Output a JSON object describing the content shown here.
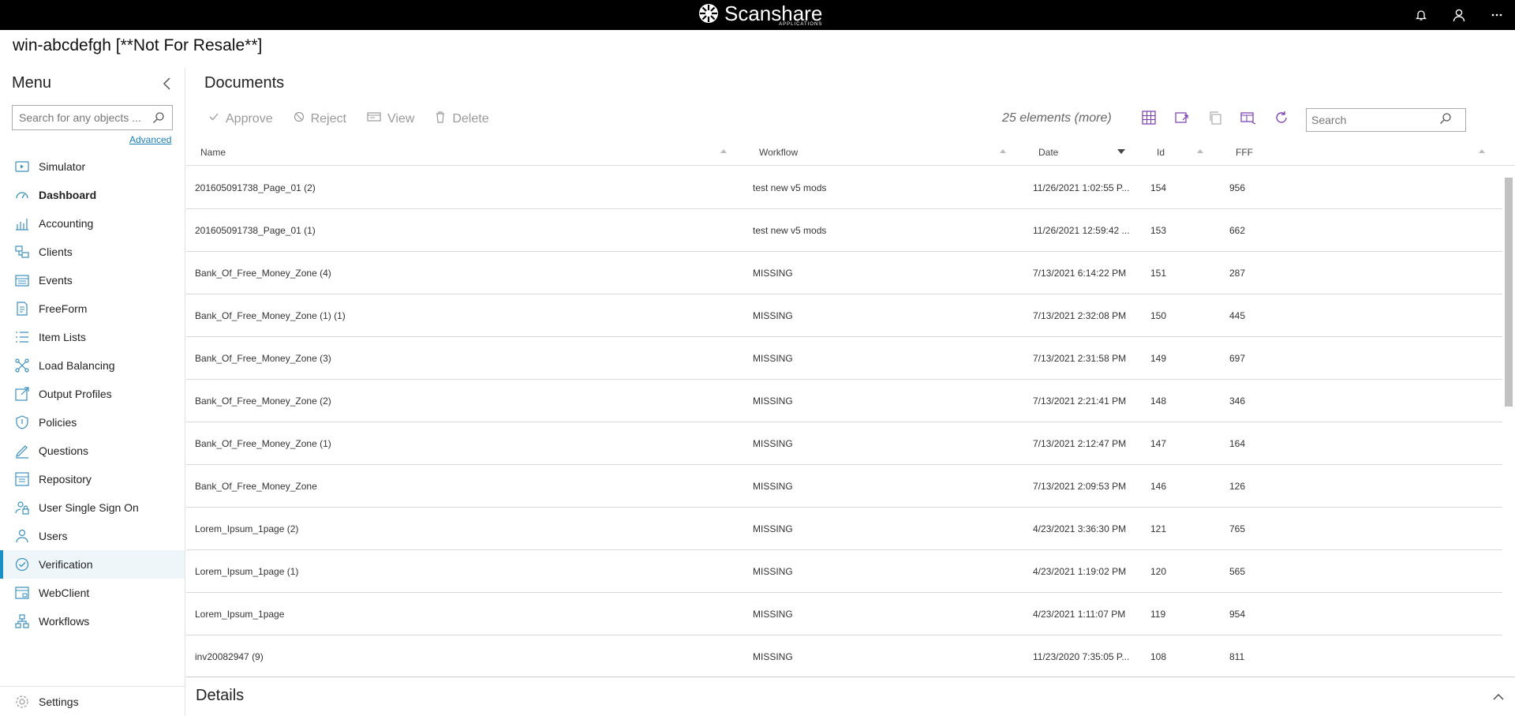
{
  "app": {
    "brand_name": "Scanshare",
    "brand_sub": "APPLICATIONS",
    "server_title": "win-abcdefgh [**Not For Resale**]"
  },
  "sidebar": {
    "title": "Menu",
    "search_placeholder": "Search for any objects ...",
    "advanced_label": "Advanced",
    "items": [
      {
        "label": "Simulator",
        "icon": "simulator-icon"
      },
      {
        "label": "Dashboard",
        "icon": "dashboard-icon",
        "bold": true
      },
      {
        "label": "Accounting",
        "icon": "accounting-icon"
      },
      {
        "label": "Clients",
        "icon": "clients-icon"
      },
      {
        "label": "Events",
        "icon": "events-icon"
      },
      {
        "label": "FreeForm",
        "icon": "freeform-icon"
      },
      {
        "label": "Item Lists",
        "icon": "item-lists-icon"
      },
      {
        "label": "Load Balancing",
        "icon": "load-balancing-icon"
      },
      {
        "label": "Output Profiles",
        "icon": "output-profiles-icon"
      },
      {
        "label": "Policies",
        "icon": "policies-icon"
      },
      {
        "label": "Questions",
        "icon": "questions-icon"
      },
      {
        "label": "Repository",
        "icon": "repository-icon"
      },
      {
        "label": "User Single Sign On",
        "icon": "sso-icon"
      },
      {
        "label": "Users",
        "icon": "users-icon"
      },
      {
        "label": "Verification",
        "icon": "verification-icon",
        "active": true
      },
      {
        "label": "WebClient",
        "icon": "webclient-icon"
      },
      {
        "label": "Workflows",
        "icon": "workflows-icon"
      }
    ],
    "settings_label": "Settings"
  },
  "main": {
    "title": "Documents",
    "toolbar": {
      "approve": "Approve",
      "reject": "Reject",
      "view": "View",
      "delete": "Delete"
    },
    "count": "25 elements (more)",
    "search_placeholder": "Search",
    "columns": {
      "name": "Name",
      "workflow": "Workflow",
      "date": "Date",
      "id": "Id",
      "fff": "FFF"
    },
    "rows": [
      {
        "name": "201605091738_Page_01 (2)",
        "workflow": "test new v5 mods",
        "date": "11/26/2021 1:02:55 P...",
        "id": "154",
        "fff": "956"
      },
      {
        "name": "201605091738_Page_01 (1)",
        "workflow": "test new v5 mods",
        "date": "11/26/2021 12:59:42 ...",
        "id": "153",
        "fff": "662"
      },
      {
        "name": "Bank_Of_Free_Money_Zone (4)",
        "workflow": "MISSING",
        "date": "7/13/2021 6:14:22 PM",
        "id": "151",
        "fff": "287"
      },
      {
        "name": "Bank_Of_Free_Money_Zone (1) (1)",
        "workflow": "MISSING",
        "date": "7/13/2021 2:32:08 PM",
        "id": "150",
        "fff": "445"
      },
      {
        "name": "Bank_Of_Free_Money_Zone (3)",
        "workflow": "MISSING",
        "date": "7/13/2021 2:31:58 PM",
        "id": "149",
        "fff": "697"
      },
      {
        "name": "Bank_Of_Free_Money_Zone (2)",
        "workflow": "MISSING",
        "date": "7/13/2021 2:21:41 PM",
        "id": "148",
        "fff": "346"
      },
      {
        "name": "Bank_Of_Free_Money_Zone (1)",
        "workflow": "MISSING",
        "date": "7/13/2021 2:12:47 PM",
        "id": "147",
        "fff": "164"
      },
      {
        "name": "Bank_Of_Free_Money_Zone",
        "workflow": "MISSING",
        "date": "7/13/2021 2:09:53 PM",
        "id": "146",
        "fff": "126"
      },
      {
        "name": "Lorem_Ipsum_1page (2)",
        "workflow": "MISSING",
        "date": "4/23/2021 3:36:30 PM",
        "id": "121",
        "fff": "765"
      },
      {
        "name": "Lorem_Ipsum_1page (1)",
        "workflow": "MISSING",
        "date": "4/23/2021 1:19:02 PM",
        "id": "120",
        "fff": "565"
      },
      {
        "name": "Lorem_Ipsum_1page",
        "workflow": "MISSING",
        "date": "4/23/2021 1:11:07 PM",
        "id": "119",
        "fff": "954"
      },
      {
        "name": "inv20082947 (9)",
        "workflow": "MISSING",
        "date": "11/23/2020 7:35:05 P...",
        "id": "108",
        "fff": "811"
      }
    ]
  },
  "details": {
    "title": "Details"
  },
  "colors": {
    "topbar": "#000000",
    "accent": "#1a8fc7",
    "link": "#1a7fb5",
    "disabled_text": "#9a9a9a"
  }
}
